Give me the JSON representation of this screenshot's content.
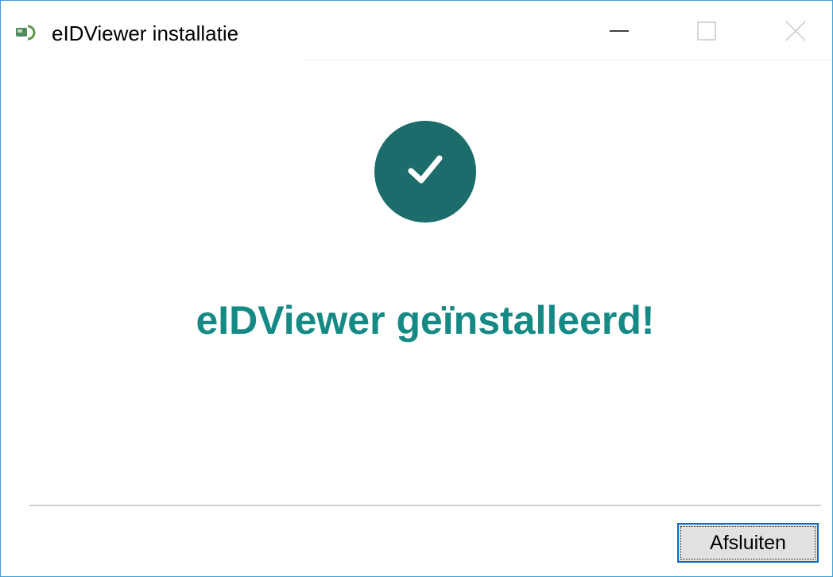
{
  "window": {
    "title": "eIDViewer installatie",
    "controls": {
      "minimize_icon": "minimize-icon",
      "maximize_icon": "maximize-icon",
      "close_icon": "close-icon"
    }
  },
  "main": {
    "status_icon": "checkmark-icon",
    "headline": "eIDViewer geïnstalleerd!"
  },
  "footer": {
    "close_button_label": "Afsluiten"
  },
  "colors": {
    "accent": "#1c6c6b",
    "headline": "#158a85",
    "focus_border": "#0f6bbd",
    "window_border": "#3c9fd6"
  }
}
